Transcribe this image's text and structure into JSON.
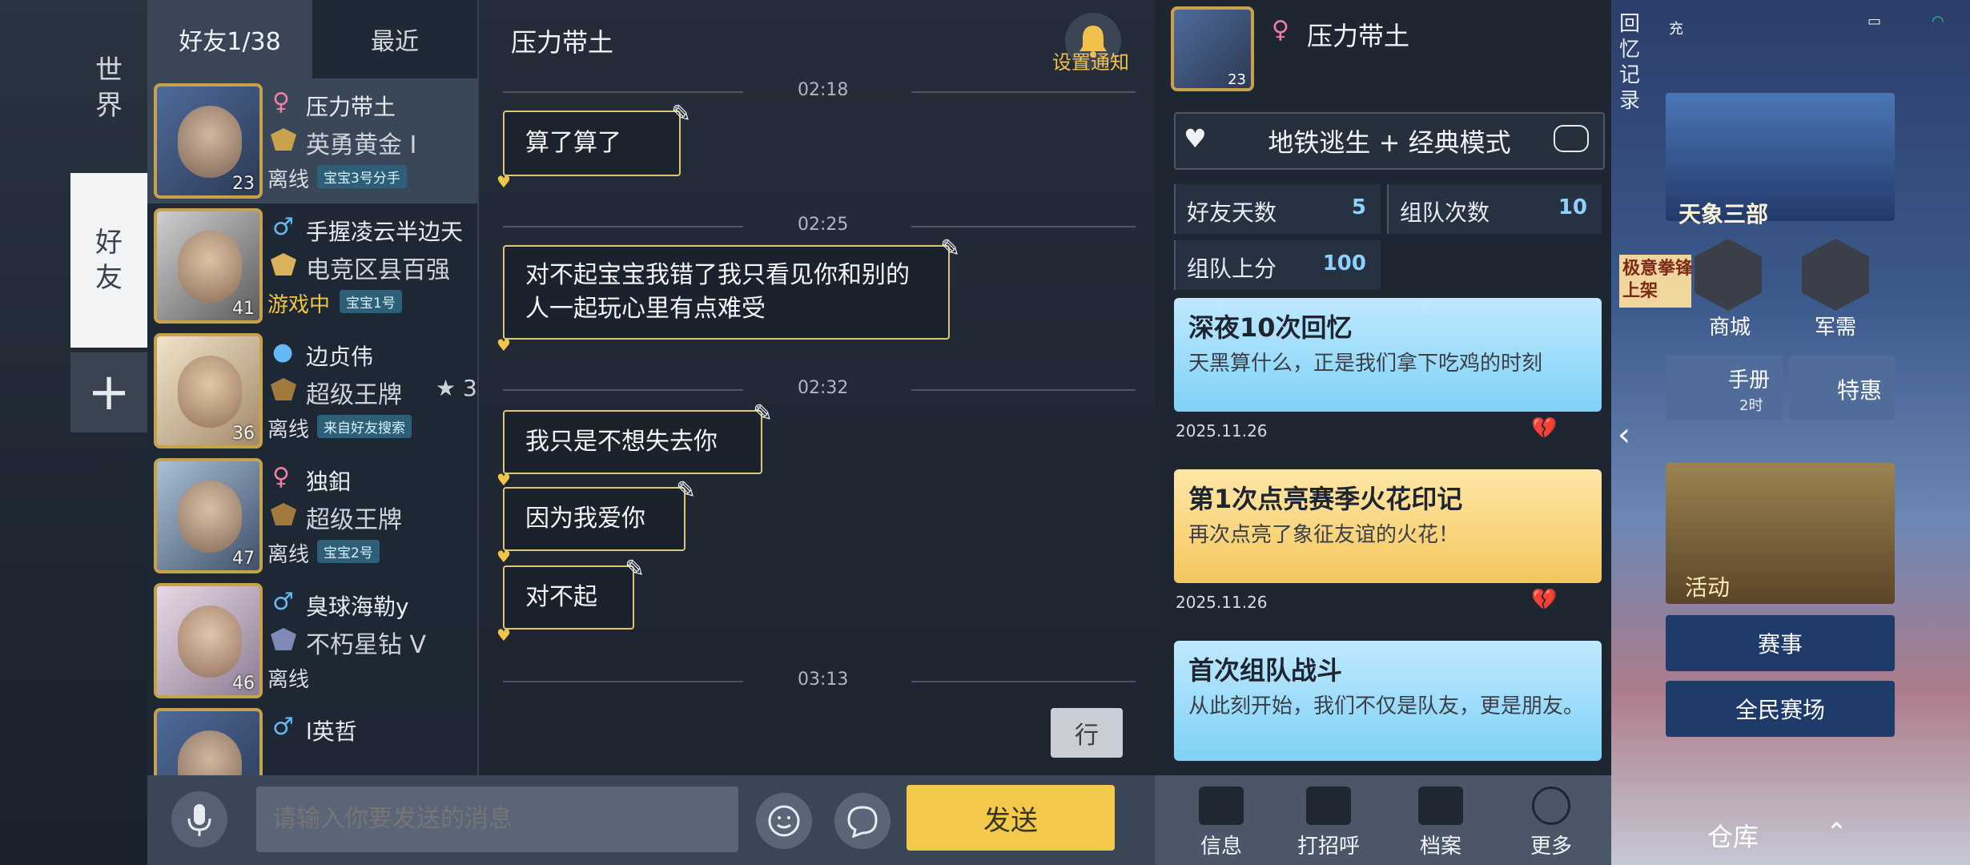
{
  "vertical_tabs": {
    "world": "世\n界",
    "friends": "好\n友",
    "add": "+"
  },
  "friend_tabs": {
    "friends": "好友1/38",
    "recent": "最近"
  },
  "friends": [
    {
      "gender": "♀",
      "name": "压力带土",
      "rank": "英勇黄金 I",
      "status": "离线",
      "tag": "宝宝3号分手",
      "level": "23",
      "online": false
    },
    {
      "gender": "♂",
      "name": "手握凌云半边天",
      "rank": "电竞区县百强",
      "status": "游戏中",
      "tag": "宝宝1号",
      "level": "41",
      "online": true
    },
    {
      "gender": "",
      "name": "边贞伟",
      "rank": "超级王牌",
      "rank_stars": "3",
      "status": "离线",
      "tag": "来自好友搜索",
      "level": "36",
      "online": false
    },
    {
      "gender": "♀",
      "name": "独鈤",
      "rank": "超级王牌",
      "status": "离线",
      "tag": "宝宝2号",
      "level": "47",
      "online": false
    },
    {
      "gender": "♂",
      "name": "臭球海勒y",
      "rank": "不朽星钻 V",
      "status": "离线",
      "tag": "",
      "level": "46",
      "online": false
    },
    {
      "gender": "♂",
      "name": "l英哲",
      "rank": "",
      "status": "",
      "tag": "",
      "level": "",
      "online": false
    }
  ],
  "chat": {
    "title": "压力带土",
    "notify_label": "设置通知",
    "times": [
      "02:18",
      "02:25",
      "02:32",
      "03:13"
    ],
    "messages": [
      "算了算了",
      "对不起宝宝我错了我只看见你和别的人一起玩心里有点难受",
      "我只是不想失去你",
      "因为我爱你",
      "对不起"
    ],
    "quick_reply": "行"
  },
  "input": {
    "placeholder": "请输入你要发送的消息",
    "send_label": "发送"
  },
  "profile": {
    "gender": "♀",
    "name": "压力带土",
    "level": "23",
    "mode": "地铁逃生 + 经典模式",
    "stats": [
      {
        "label": "好友天数",
        "value": "5"
      },
      {
        "label": "组队次数",
        "value": "10"
      },
      {
        "label": "组队上分",
        "value": "100"
      }
    ],
    "cards": [
      {
        "title": "深夜10次回忆",
        "desc": "天黑算什么，正是我们拿下吃鸡的时刻",
        "date": "2025.11.26",
        "style": "blue"
      },
      {
        "title": "第1次点亮赛季火花印记",
        "desc": "再次点亮了象征友谊的火花！",
        "date": "2025.11.26",
        "style": "gold"
      },
      {
        "title": "首次组队战斗",
        "desc": "从此刻开始，我们不仅是队友，更是朋友。",
        "date": "",
        "style": "blue"
      }
    ],
    "bottom_buttons": [
      "信息",
      "打招呼",
      "档案",
      "更多"
    ]
  },
  "lobby": {
    "memory_label": "回\n忆\n记\n录",
    "sys_text": "充",
    "banner_title": "天象三部",
    "promo": "极意拳锋\n上架",
    "shop": "商城",
    "military": "军需",
    "handbook": "手册",
    "handbook_sub": "2时",
    "deal": "特惠",
    "activity": "活动",
    "esports": "赛事",
    "arena": "全民赛场",
    "warehouse": "仓库"
  }
}
